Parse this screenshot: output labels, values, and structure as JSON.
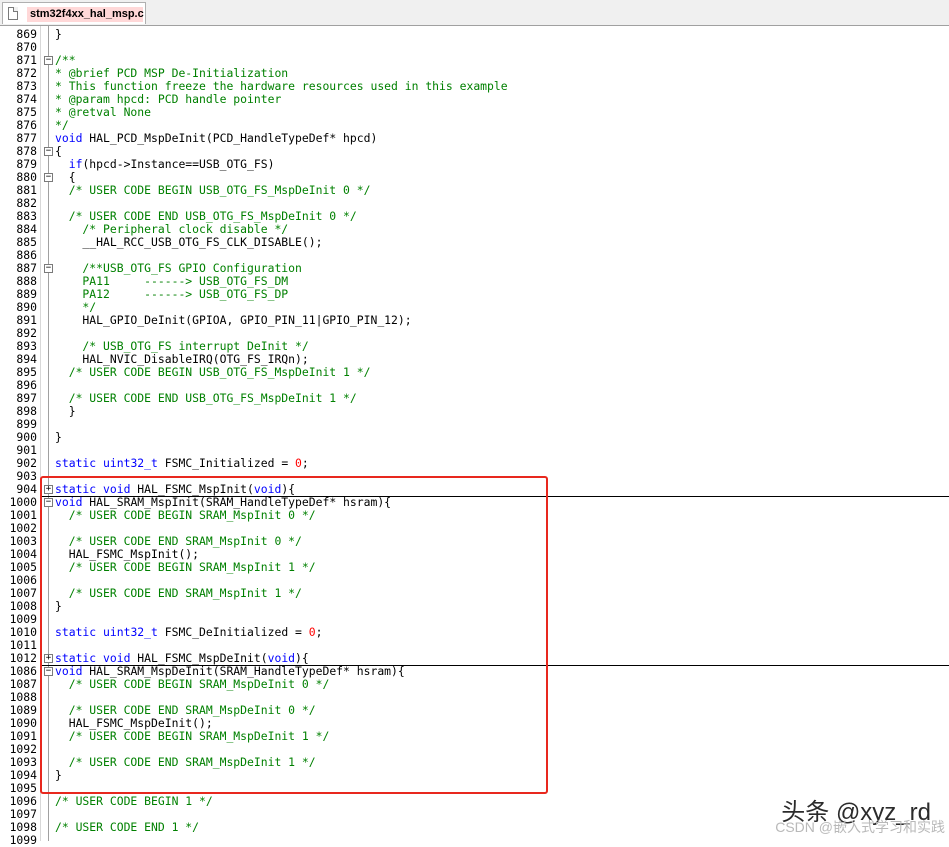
{
  "tab": {
    "file_icon": "file-icon",
    "filename": "stm32f4xx_hal_msp.c"
  },
  "colors": {
    "keyword": "#0000ff",
    "comment": "#008000",
    "number": "#ff0000",
    "highlight_box": "#e8281e",
    "tab_label_bg": "#ffd8d8"
  },
  "lines": [
    {
      "n": "869",
      "t": "}"
    },
    {
      "n": "870",
      "t": ""
    },
    {
      "n": "871",
      "t": "/**",
      "fold": "-",
      "c": 1
    },
    {
      "n": "872",
      "t": "* @brief PCD MSP De-Initialization",
      "c": 1
    },
    {
      "n": "873",
      "t": "* This function freeze the hardware resources used in this example",
      "c": 1
    },
    {
      "n": "874",
      "t": "* @param hpcd: PCD handle pointer",
      "c": 1
    },
    {
      "n": "875",
      "t": "* @retval None",
      "c": 1
    },
    {
      "n": "876",
      "t": "*/",
      "c": 1
    },
    {
      "n": "877",
      "t": "void HAL_PCD_MspDeInit(PCD_HandleTypeDef* hpcd)"
    },
    {
      "n": "878",
      "t": "{",
      "fold": "-"
    },
    {
      "n": "879",
      "t": "  if(hpcd->Instance==USB_OTG_FS)"
    },
    {
      "n": "880",
      "t": "  {",
      "fold": "-"
    },
    {
      "n": "881",
      "t": "  /* USER CODE BEGIN USB_OTG_FS_MspDeInit 0 */",
      "c": 1
    },
    {
      "n": "882",
      "t": ""
    },
    {
      "n": "883",
      "t": "  /* USER CODE END USB_OTG_FS_MspDeInit 0 */",
      "c": 1
    },
    {
      "n": "884",
      "t": "    /* Peripheral clock disable */",
      "c": 1
    },
    {
      "n": "885",
      "t": "    __HAL_RCC_USB_OTG_FS_CLK_DISABLE();"
    },
    {
      "n": "886",
      "t": ""
    },
    {
      "n": "887",
      "t": "    /**USB_OTG_FS GPIO Configuration",
      "fold": "-",
      "c": 1
    },
    {
      "n": "888",
      "t": "    PA11     ------> USB_OTG_FS_DM",
      "c": 1
    },
    {
      "n": "889",
      "t": "    PA12     ------> USB_OTG_FS_DP",
      "c": 1
    },
    {
      "n": "890",
      "t": "    */",
      "c": 1
    },
    {
      "n": "891",
      "t": "    HAL_GPIO_DeInit(GPIOA, GPIO_PIN_11|GPIO_PIN_12);"
    },
    {
      "n": "892",
      "t": ""
    },
    {
      "n": "893",
      "t": "    /* USB_OTG_FS interrupt DeInit */",
      "c": 1
    },
    {
      "n": "894",
      "t": "    HAL_NVIC_DisableIRQ(OTG_FS_IRQn);"
    },
    {
      "n": "895",
      "t": "  /* USER CODE BEGIN USB_OTG_FS_MspDeInit 1 */",
      "c": 1
    },
    {
      "n": "896",
      "t": ""
    },
    {
      "n": "897",
      "t": "  /* USER CODE END USB_OTG_FS_MspDeInit 1 */",
      "c": 1
    },
    {
      "n": "898",
      "t": "  }"
    },
    {
      "n": "899",
      "t": ""
    },
    {
      "n": "900",
      "t": "}"
    },
    {
      "n": "901",
      "t": ""
    },
    {
      "n": "902",
      "t": "static uint32_t FSMC_Initialized = 0;"
    },
    {
      "n": "903",
      "t": ""
    },
    {
      "n": "904",
      "t": "static void HAL_FSMC_MspInit(void){",
      "fold": "+",
      "sep": 1
    },
    {
      "n": "1000",
      "t": "void HAL_SRAM_MspInit(SRAM_HandleTypeDef* hsram){",
      "fold": "-"
    },
    {
      "n": "1001",
      "t": "  /* USER CODE BEGIN SRAM_MspInit 0 */",
      "c": 1
    },
    {
      "n": "1002",
      "t": ""
    },
    {
      "n": "1003",
      "t": "  /* USER CODE END SRAM_MspInit 0 */",
      "c": 1
    },
    {
      "n": "1004",
      "t": "  HAL_FSMC_MspInit();"
    },
    {
      "n": "1005",
      "t": "  /* USER CODE BEGIN SRAM_MspInit 1 */",
      "c": 1
    },
    {
      "n": "1006",
      "t": ""
    },
    {
      "n": "1007",
      "t": "  /* USER CODE END SRAM_MspInit 1 */",
      "c": 1
    },
    {
      "n": "1008",
      "t": "}"
    },
    {
      "n": "1009",
      "t": ""
    },
    {
      "n": "1010",
      "t": "static uint32_t FSMC_DeInitialized = 0;"
    },
    {
      "n": "1011",
      "t": ""
    },
    {
      "n": "1012",
      "t": "static void HAL_FSMC_MspDeInit(void){",
      "fold": "+",
      "sep": 1
    },
    {
      "n": "1086",
      "t": "void HAL_SRAM_MspDeInit(SRAM_HandleTypeDef* hsram){",
      "fold": "-"
    },
    {
      "n": "1087",
      "t": "  /* USER CODE BEGIN SRAM_MspDeInit 0 */",
      "c": 1
    },
    {
      "n": "1088",
      "t": ""
    },
    {
      "n": "1089",
      "t": "  /* USER CODE END SRAM_MspDeInit 0 */",
      "c": 1
    },
    {
      "n": "1090",
      "t": "  HAL_FSMC_MspDeInit();"
    },
    {
      "n": "1091",
      "t": "  /* USER CODE BEGIN SRAM_MspDeInit 1 */",
      "c": 1
    },
    {
      "n": "1092",
      "t": ""
    },
    {
      "n": "1093",
      "t": "  /* USER CODE END SRAM_MspDeInit 1 */",
      "c": 1
    },
    {
      "n": "1094",
      "t": "}"
    },
    {
      "n": "1095",
      "t": ""
    },
    {
      "n": "1096",
      "t": "/* USER CODE BEGIN 1 */",
      "c": 1
    },
    {
      "n": "1097",
      "t": ""
    },
    {
      "n": "1098",
      "t": "/* USER CODE END 1 */",
      "c": 1
    },
    {
      "n": "1099",
      "t": ""
    }
  ],
  "watermark": {
    "main": "头条 @xyz_rd",
    "sub": "CSDN @嵌入式学习和实践"
  }
}
